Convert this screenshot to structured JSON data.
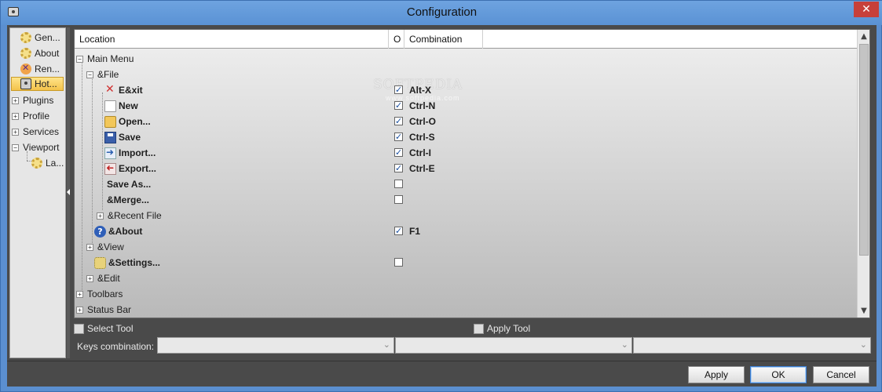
{
  "window": {
    "title": "Configuration",
    "close_glyph": "✕"
  },
  "nav": {
    "items": [
      {
        "label": "Gen...",
        "icon": "gear-icon"
      },
      {
        "label": "About",
        "icon": "gear-icon"
      },
      {
        "label": "Ren...",
        "icon": "render-icon"
      },
      {
        "label": "Hot...",
        "icon": "hotkey-icon",
        "selected": true
      },
      {
        "label": "Plugins",
        "expander": "+"
      },
      {
        "label": "Profile",
        "expander": "+"
      },
      {
        "label": "Services",
        "expander": "+"
      },
      {
        "label": "Viewport",
        "expander": "−"
      },
      {
        "label": "La...",
        "icon": "gear-icon"
      }
    ]
  },
  "grid": {
    "headers": {
      "location": "Location",
      "o": "O",
      "combination": "Combination"
    },
    "rows": [
      {
        "label": "Main Menu",
        "expander": "−"
      },
      {
        "label": "&File",
        "expander": "−"
      },
      {
        "label": "E&xit",
        "icon": "exit-icon",
        "checked": true,
        "combo": "Alt-X"
      },
      {
        "label": "New",
        "icon": "new-file-icon",
        "checked": true,
        "combo": "Ctrl-N"
      },
      {
        "label": "Open...",
        "icon": "open-folder-icon",
        "checked": true,
        "combo": "Ctrl-O"
      },
      {
        "label": "Save",
        "icon": "save-icon",
        "checked": true,
        "combo": "Ctrl-S"
      },
      {
        "label": "Import...",
        "icon": "import-icon",
        "checked": true,
        "combo": "Ctrl-I"
      },
      {
        "label": "Export...",
        "icon": "export-icon",
        "checked": true,
        "combo": "Ctrl-E"
      },
      {
        "label": "Save As...",
        "checked": false,
        "combo": ""
      },
      {
        "label": "&Merge...",
        "checked": false,
        "combo": ""
      },
      {
        "label": "&Recent File",
        "expander": "+"
      },
      {
        "label": "&About",
        "icon": "about-icon",
        "checked": true,
        "combo": "F1"
      },
      {
        "label": "&View",
        "expander": "+"
      },
      {
        "label": "&Settings...",
        "icon": "settings-icon",
        "checked": false,
        "combo": ""
      },
      {
        "label": "&Edit",
        "expander": "+"
      },
      {
        "label": "Toolbars",
        "expander": "+"
      },
      {
        "label": "Status Bar",
        "expander": "+"
      }
    ],
    "check_glyph": "✓",
    "watermark": "SOFTPEDIA",
    "watermark_sub": "www.softpedia.com"
  },
  "controls": {
    "select_tool": "Select Tool",
    "apply_tool": "Apply Tool",
    "keys_combination_label": "Keys combination:",
    "dropdown_arrow": "⌄"
  },
  "buttons": {
    "apply": "Apply",
    "ok": "OK",
    "cancel": "Cancel"
  },
  "scrollbar": {
    "up": "▲",
    "down": "▼"
  }
}
